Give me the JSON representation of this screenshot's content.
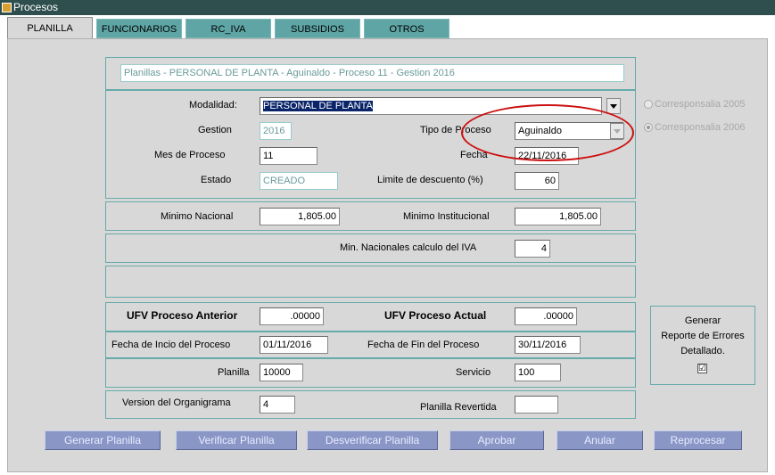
{
  "window": {
    "title": "Procesos"
  },
  "tabs": [
    "PLANILLA",
    "FUNCIONARIOS",
    "RC_IVA",
    "SUBSIDIOS",
    "OTROS"
  ],
  "header_text": "Planillas  - PERSONAL DE PLANTA -  Aguinaldo -  Proceso 11 - Gestion 2016",
  "form": {
    "modalidad": {
      "label": "Modalidad:",
      "value": "PERSONAL DE PLANTA"
    },
    "gestion": {
      "label": "Gestion",
      "value": "2016"
    },
    "tipo_proceso": {
      "label": "Tipo de Proceso",
      "value": "Aguinaldo"
    },
    "mes_proceso": {
      "label": "Mes de Proceso",
      "value": "11"
    },
    "fecha": {
      "label": "Fecha",
      "value": "22/11/2016"
    },
    "estado": {
      "label": "Estado",
      "value": "CREADO"
    },
    "limite_descuento": {
      "label": "Limite de descuento (%)",
      "value": "60"
    },
    "minimo_nacional": {
      "label": "Minimo Nacional",
      "value": "1,805.00"
    },
    "minimo_institucional": {
      "label": "Minimo Institucional",
      "value": "1,805.00"
    },
    "min_nacionales_iva": {
      "label": "Min. Nacionales  calculo del IVA",
      "value": "4"
    },
    "ufv_anterior": {
      "label": "UFV Proceso Anterior",
      "value": ".00000"
    },
    "ufv_actual": {
      "label": "UFV Proceso Actual",
      "value": ".00000"
    },
    "fecha_inicio": {
      "label": "Fecha de Incio del Proceso",
      "value": "01/11/2016"
    },
    "fecha_fin": {
      "label": "Fecha de Fin del  Proceso",
      "value": "30/11/2016"
    },
    "planilla": {
      "label": "Planilla",
      "value": "10000"
    },
    "servicio": {
      "label": "Servicio",
      "value": "100"
    },
    "version_organigrama": {
      "label": "Version del Organigrama",
      "value": "4"
    },
    "planilla_revertida": {
      "label": "Planilla Revertida",
      "value": ""
    }
  },
  "radios": [
    {
      "label": "Corresponsalia 2005",
      "selected": false
    },
    {
      "label": "Corresponsalia 2006",
      "selected": true
    }
  ],
  "error_report": {
    "line1": "Generar",
    "line2": "Reporte de Errores",
    "line3": "Detallado.",
    "checked": true,
    "check_glyph": "☑"
  },
  "buttons": [
    "Generar Planilla",
    "Verificar Planilla",
    "Desverificar Planilla",
    "Aprobar",
    "Anular",
    "Reprocesar"
  ],
  "colors": {
    "title_bar": "#2f4f4f",
    "tab_inactive": "#5fa5a5",
    "button": "#8a96c6",
    "highlight_ellipse": "#cc1111"
  }
}
